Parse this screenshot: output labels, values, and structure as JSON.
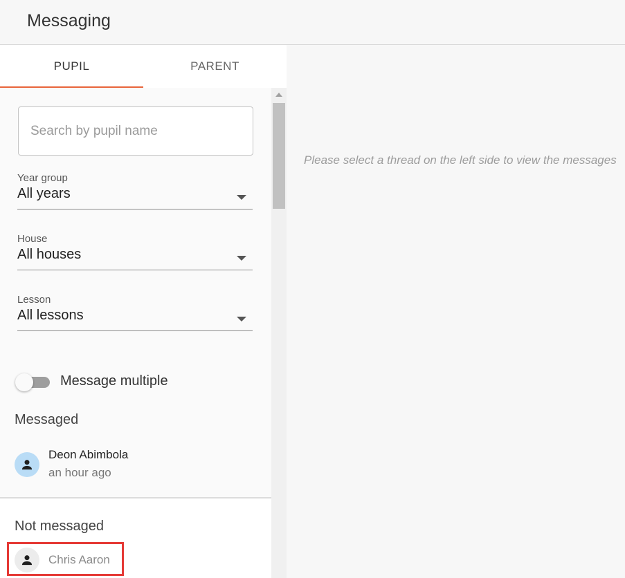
{
  "header": {
    "title": "Messaging"
  },
  "tabs": [
    {
      "label": "PUPIL",
      "active": true
    },
    {
      "label": "PARENT",
      "active": false
    }
  ],
  "search": {
    "placeholder": "Search by pupil name",
    "value": ""
  },
  "filters": {
    "year_group": {
      "label": "Year group",
      "value": "All years"
    },
    "house": {
      "label": "House",
      "value": "All houses"
    },
    "lesson": {
      "label": "Lesson",
      "value": "All lessons"
    }
  },
  "toggle": {
    "label": "Message multiple",
    "on": false
  },
  "messaged": {
    "title": "Messaged",
    "items": [
      {
        "name": "Deon Abimbola",
        "time": "an hour ago",
        "icon": "person-icon"
      }
    ]
  },
  "not_messaged": {
    "title": "Not messaged",
    "items": [
      {
        "name": "Chris Aaron",
        "icon": "person-icon"
      }
    ]
  },
  "right_panel": {
    "hint": "Please select a thread on the left side to view the messages"
  },
  "colors": {
    "accent": "#e8643a",
    "highlight": "#e53935",
    "avatar_messaged": "#b9dcf6"
  }
}
